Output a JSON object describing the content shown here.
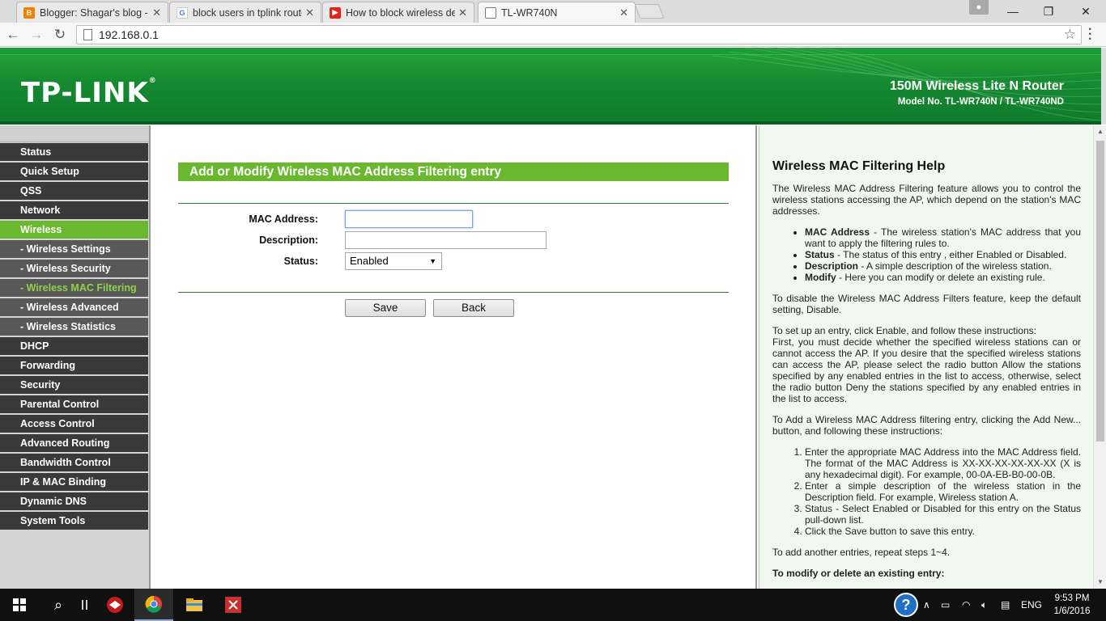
{
  "browser": {
    "tabs": [
      {
        "title": "Blogger: Shagar's blog - C",
        "icon": "blogger-icon",
        "color": "#f57d00"
      },
      {
        "title": "block users in tplink router",
        "icon": "google-icon",
        "color": "#4285f4"
      },
      {
        "title": "How to block wireless dev",
        "icon": "youtube-icon",
        "color": "#e62117"
      },
      {
        "title": "TL-WR740N",
        "icon": "page-icon",
        "color": "#ffffff"
      }
    ],
    "url": "192.168.0.1"
  },
  "header": {
    "logo": "TP-LINK",
    "logo_mark": "®",
    "product": "150M Wireless Lite N Router",
    "model": "Model No. TL-WR740N / TL-WR740ND",
    "brand_color": "#1a8f33"
  },
  "sidebar": {
    "items": [
      {
        "label": "Status",
        "sub": false,
        "active": false
      },
      {
        "label": "Quick Setup",
        "sub": false,
        "active": false
      },
      {
        "label": "QSS",
        "sub": false,
        "active": false
      },
      {
        "label": "Network",
        "sub": false,
        "active": false
      },
      {
        "label": "Wireless",
        "sub": false,
        "active": true
      },
      {
        "label": "- Wireless Settings",
        "sub": true,
        "active": false
      },
      {
        "label": "- Wireless Security",
        "sub": true,
        "active": false
      },
      {
        "label": "- Wireless MAC Filtering",
        "sub": true,
        "active": true
      },
      {
        "label": "- Wireless Advanced",
        "sub": true,
        "active": false
      },
      {
        "label": "- Wireless Statistics",
        "sub": true,
        "active": false
      },
      {
        "label": "DHCP",
        "sub": false,
        "active": false
      },
      {
        "label": "Forwarding",
        "sub": false,
        "active": false
      },
      {
        "label": "Security",
        "sub": false,
        "active": false
      },
      {
        "label": "Parental Control",
        "sub": false,
        "active": false
      },
      {
        "label": "Access Control",
        "sub": false,
        "active": false
      },
      {
        "label": "Advanced Routing",
        "sub": false,
        "active": false
      },
      {
        "label": "Bandwidth Control",
        "sub": false,
        "active": false
      },
      {
        "label": "IP & MAC Binding",
        "sub": false,
        "active": false
      },
      {
        "label": "Dynamic DNS",
        "sub": false,
        "active": false
      },
      {
        "label": "System Tools",
        "sub": false,
        "active": false
      }
    ],
    "active_color": "#6ab82e"
  },
  "form": {
    "title": "Add or Modify Wireless MAC Address Filtering entry",
    "mac_label": "MAC Address:",
    "mac_value": "",
    "desc_label": "Description:",
    "desc_value": "",
    "status_label": "Status:",
    "status_value": "Enabled",
    "save_label": "Save",
    "back_label": "Back"
  },
  "help": {
    "title": "Wireless MAC Filtering Help",
    "intro": "The Wireless MAC Address Filtering feature allows you to control the wireless stations accessing the AP, which depend on the station's MAC addresses.",
    "bullets": [
      {
        "term": "MAC Address",
        "text": " - The wireless station's MAC address that you want to apply the filtering rules to."
      },
      {
        "term": "Status",
        "text": " - The status of this entry , either Enabled or Disabled."
      },
      {
        "term": "Description",
        "text": " - A simple description of the wireless station."
      },
      {
        "term": "Modify",
        "text": " - Here you can modify or delete an existing rule."
      }
    ],
    "disable": "To disable the Wireless MAC Address Filters feature, keep the default setting, Disable.",
    "setup_1": "To set up an entry, click Enable, and follow these instructions:",
    "setup_2": "First, you must decide whether the specified wireless stations can or cannot access the AP. If you desire that the specified wireless stations can access the AP, please select the radio button Allow the stations specified by any enabled entries in the list to access, otherwise, select the radio button Deny the stations specified by any enabled entries in the list to access.",
    "add": "To Add a Wireless MAC Address filtering entry, clicking the Add New... button, and following these instructions:",
    "steps": [
      "Enter the appropriate MAC Address into the MAC Address field. The format of the MAC Address is XX-XX-XX-XX-XX-XX (X is any hexadecimal digit). For example, 00-0A-EB-B0-00-0B.",
      "Enter a simple description of the wireless station in the Description field. For example, Wireless station A.",
      "Status - Select Enabled or Disabled for this entry on the Status pull-down list.",
      "Click the Save button to save this entry."
    ],
    "repeat": "To add another entries, repeat steps 1~4.",
    "modify": "To modify or delete an existing entry:"
  },
  "taskbar": {
    "lang": "ENG",
    "time": "9:53 PM",
    "date": "1/6/2016"
  }
}
